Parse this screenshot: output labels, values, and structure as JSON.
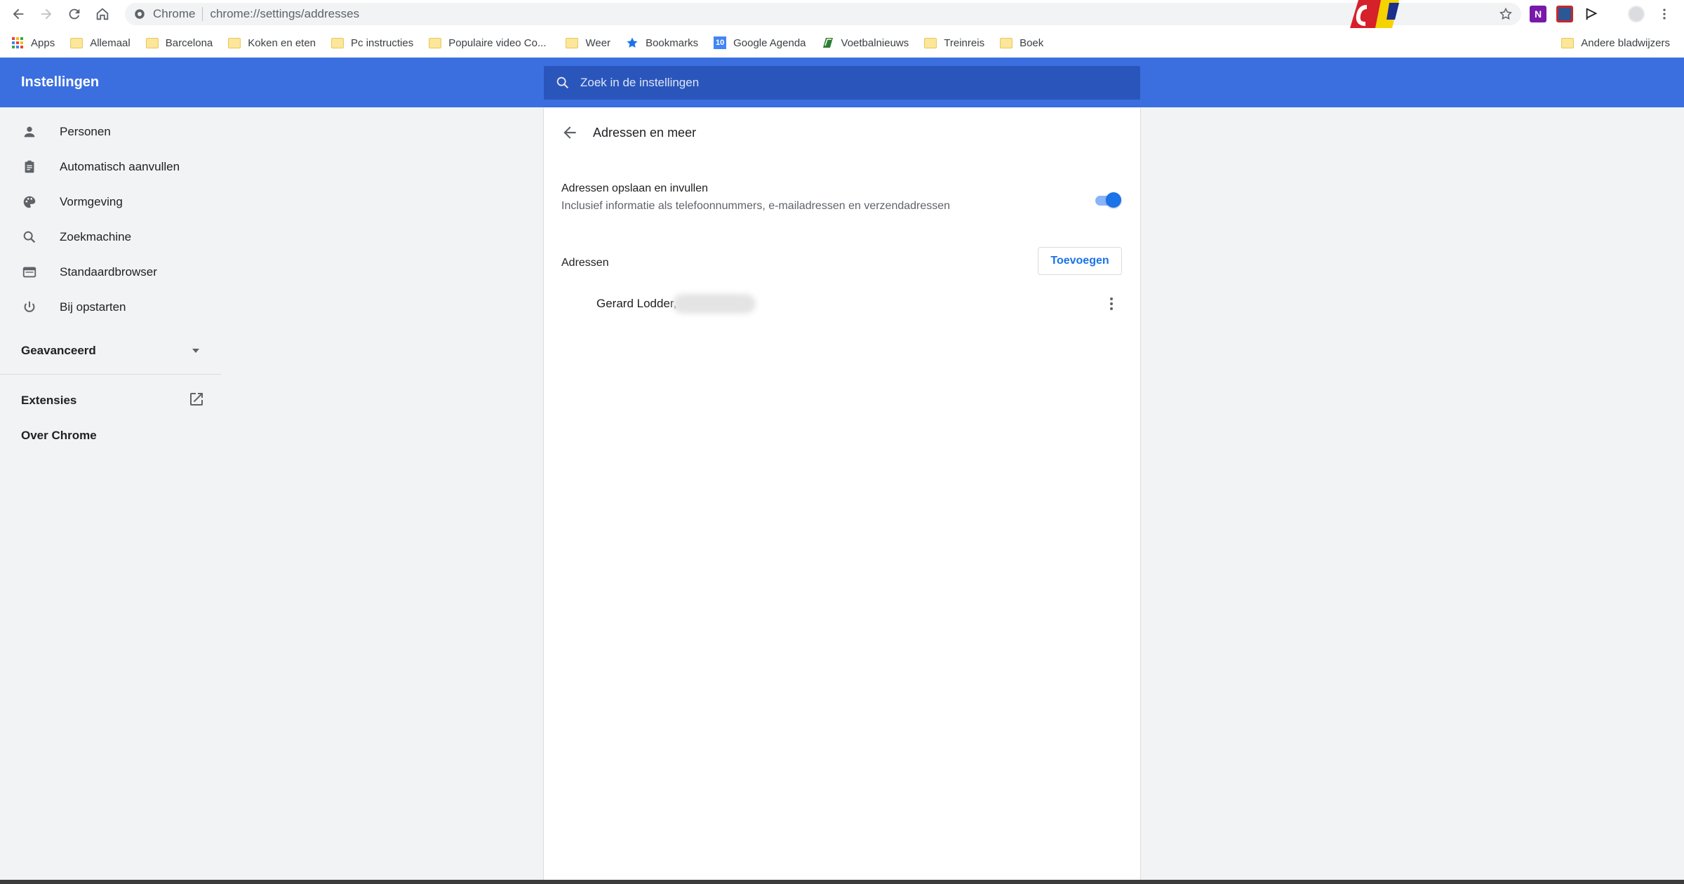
{
  "browser": {
    "site_name": "Chrome",
    "url": "chrome://settings/addresses"
  },
  "bookmarks": [
    {
      "label": "Apps",
      "icon": "apps-grid-icon"
    },
    {
      "label": "Allemaal",
      "icon": "folder-icon"
    },
    {
      "label": "Barcelona",
      "icon": "folder-icon"
    },
    {
      "label": "Koken en eten",
      "icon": "folder-icon"
    },
    {
      "label": "Pc instructies",
      "icon": "folder-icon"
    },
    {
      "label": "Populaire video Co...",
      "icon": "folder-icon"
    },
    {
      "label": "Weer",
      "icon": "folder-icon"
    },
    {
      "label": "Bookmarks",
      "icon": "star-icon"
    },
    {
      "label": "Google Agenda",
      "icon": "calendar-icon"
    },
    {
      "label": "Voetbalnieuws",
      "icon": "news-icon"
    },
    {
      "label": "Treinreis",
      "icon": "folder-icon"
    },
    {
      "label": "Boek",
      "icon": "folder-icon"
    }
  ],
  "other_bookmarks": "Andere bladwijzers",
  "header": {
    "title": "Instellingen",
    "search_placeholder": "Zoek in de instellingen"
  },
  "sidebar": {
    "items": [
      {
        "label": "Personen",
        "icon": "person-icon"
      },
      {
        "label": "Automatisch aanvullen",
        "icon": "clipboard-icon"
      },
      {
        "label": "Vormgeving",
        "icon": "palette-icon"
      },
      {
        "label": "Zoekmachine",
        "icon": "search-icon"
      },
      {
        "label": "Standaardbrowser",
        "icon": "browser-icon"
      },
      {
        "label": "Bij opstarten",
        "icon": "power-icon"
      }
    ],
    "advanced": "Geavanceerd",
    "extensions": "Extensies",
    "about": "Over Chrome"
  },
  "page": {
    "title": "Adressen en meer",
    "toggle_title": "Adressen opslaan en invullen",
    "toggle_subtitle": "Inclusief informatie als telefoonnummers, e-mailadressen en verzendadressen",
    "toggle_on": true,
    "section_label": "Adressen",
    "add_button": "Toevoegen",
    "addresses": [
      {
        "name": "Gerard Lodder,"
      }
    ]
  },
  "colors": {
    "header_blue": "#3b6fe0",
    "accent": "#1a73e8"
  }
}
